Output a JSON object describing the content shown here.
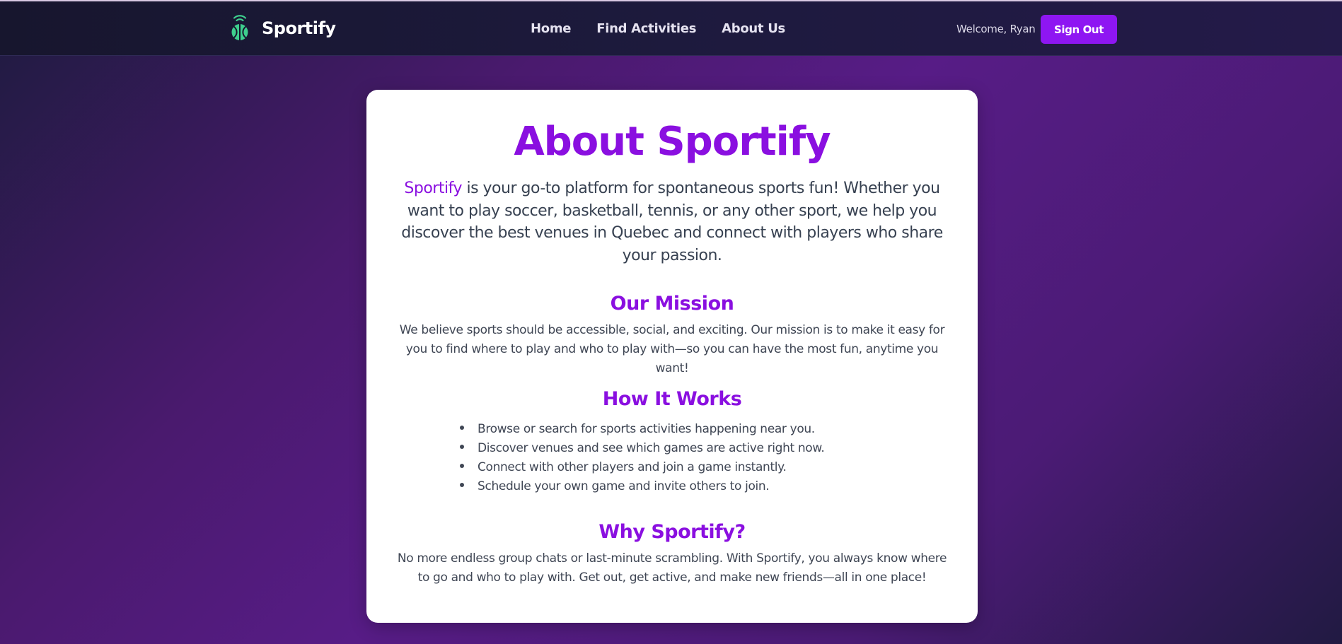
{
  "colors": {
    "accent": "#8a0fe0",
    "button": "#8e16f2",
    "brand_icon": "#3ecf8e"
  },
  "navbar": {
    "brand": "Sportify",
    "brand_icon": "basketball-signal-icon",
    "links": [
      "Home",
      "Find Activities",
      "About Us"
    ],
    "welcome": "Welcome, Ryan",
    "sign_out": "Sign Out"
  },
  "about": {
    "title": "About Sportify",
    "intro_highlight": "Sportify",
    "intro_rest": " is your go-to platform for spontaneous sports fun! Whether you want to play soccer, basketball, tennis, or any other sport, we help you discover the best venues in Quebec and connect with players who share your passion.",
    "mission": {
      "heading": "Our Mission",
      "text": "We believe sports should be accessible, social, and exciting. Our mission is to make it easy for you to find where to play and who to play with—so you can have the most fun, anytime you want!"
    },
    "how": {
      "heading": "How It Works",
      "steps": [
        "Browse or search for sports activities happening near you.",
        "Discover venues and see which games are active right now.",
        "Connect with other players and join a game instantly.",
        "Schedule your own game and invite others to join."
      ]
    },
    "why": {
      "heading": "Why Sportify?",
      "text": "No more endless group chats or last-minute scrambling. With Sportify, you always know where to go and who to play with. Get out, get active, and make new friends—all in one place!"
    }
  }
}
